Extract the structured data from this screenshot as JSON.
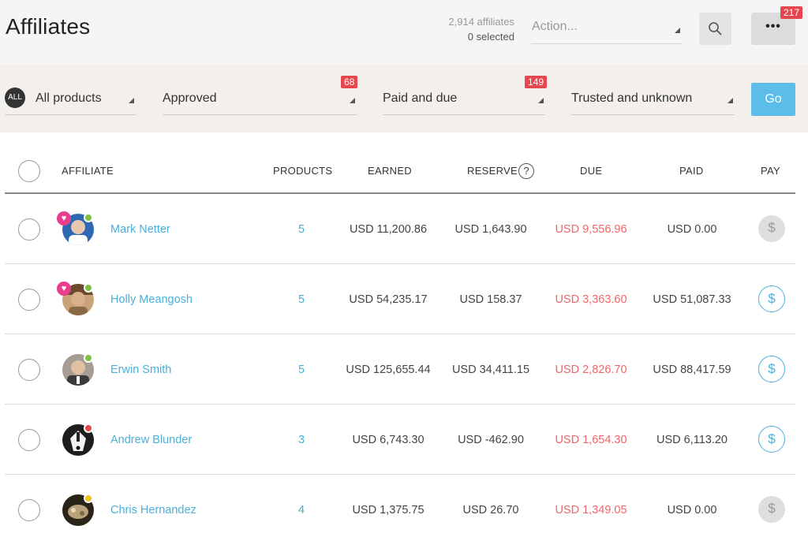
{
  "header": {
    "title": "Affiliates",
    "count_text": "2,914 affiliates",
    "selected_text": "0 selected",
    "action_placeholder": "Action...",
    "more_label": "•••",
    "more_badge": "217"
  },
  "filters": {
    "products": {
      "badge_text": "ALL",
      "label": "All products"
    },
    "status": {
      "label": "Approved",
      "badge": "68"
    },
    "payment": {
      "label": "Paid and due",
      "badge": "149"
    },
    "trust": {
      "label": "Trusted and unknown"
    },
    "go_label": "Go"
  },
  "table": {
    "columns": {
      "affiliate": "AFFILIATE",
      "products": "PRODUCTS",
      "earned": "EARNED",
      "reserve": "RESERVE",
      "reserve_help": "?",
      "due": "DUE",
      "paid": "PAID",
      "pay": "PAY"
    },
    "rows": [
      {
        "name": "Mark Netter",
        "products": "5",
        "earned": "USD 11,200.86",
        "reserve": "USD 1,643.90",
        "due": "USD 9,556.96",
        "paid": "USD 0.00",
        "pay_enabled": false,
        "favorite": true,
        "status_color": "#7cc142"
      },
      {
        "name": "Holly Meangosh",
        "products": "5",
        "earned": "USD 54,235.17",
        "reserve": "USD 158.37",
        "due": "USD 3,363.60",
        "paid": "USD 51,087.33",
        "pay_enabled": true,
        "favorite": true,
        "status_color": "#7cc142"
      },
      {
        "name": "Erwin Smith",
        "products": "5",
        "earned": "USD 125,655.44",
        "reserve": "USD 34,411.15",
        "due": "USD 2,826.70",
        "paid": "USD 88,417.59",
        "pay_enabled": true,
        "favorite": false,
        "status_color": "#7cc142"
      },
      {
        "name": "Andrew Blunder",
        "products": "3",
        "earned": "USD 6,743.30",
        "reserve": "USD -462.90",
        "due": "USD 1,654.30",
        "paid": "USD 6,113.20",
        "pay_enabled": true,
        "favorite": false,
        "status_color": "#e5474f"
      },
      {
        "name": "Chris Hernandez",
        "products": "4",
        "earned": "USD 1,375.75",
        "reserve": "USD 26.70",
        "due": "USD 1,349.05",
        "paid": "USD 0.00",
        "pay_enabled": false,
        "favorite": false,
        "status_color": "#f0c419"
      }
    ]
  },
  "icons": {
    "pay": "dollar-icon",
    "search": "search-icon",
    "favorite": "heart-icon"
  },
  "colors": {
    "accent": "#4ab0d9",
    "due": "#ef6668",
    "badge": "#e5474f",
    "go": "#5bbde8"
  }
}
